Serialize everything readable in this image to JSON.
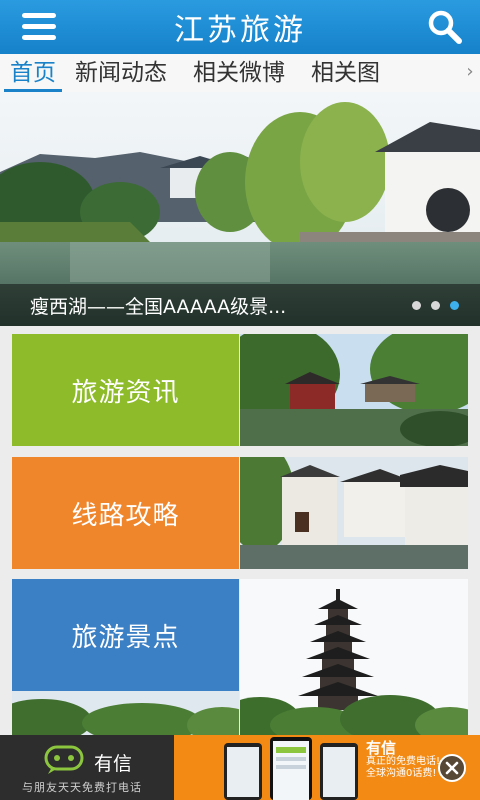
{
  "header": {
    "title": "江苏旅游",
    "menu_icon": "menu-icon",
    "search_icon": "search-icon"
  },
  "tabs": [
    {
      "label": "首页",
      "active": true
    },
    {
      "label": "新闻动态",
      "active": false
    },
    {
      "label": "相关微博",
      "active": false
    },
    {
      "label": "相关图",
      "active": false
    }
  ],
  "tabs_more": "›",
  "banner": {
    "caption": "瘦西湖——全国AAAAA级景...",
    "slide_count": 3,
    "active_slide": 3
  },
  "tiles": [
    {
      "label": "旅游资讯",
      "color": "#8dbb2a"
    },
    {
      "label": "线路攻略",
      "color": "#f0862c"
    },
    {
      "label": "旅游景点",
      "color": "#3b7fc4"
    }
  ],
  "ad": {
    "brand": "有信",
    "slogan": "与朋友天天免费打电话",
    "title": "有信",
    "desc_line1": "真正的免费电话!",
    "desc_line2": "全球沟通0话费!",
    "close_icon": "close-icon",
    "left_bg": "#2d2d2d",
    "right_bg": "#f28a14"
  },
  "colors": {
    "accent": "#1a82c8",
    "header_bg": "#1e8fd6"
  }
}
